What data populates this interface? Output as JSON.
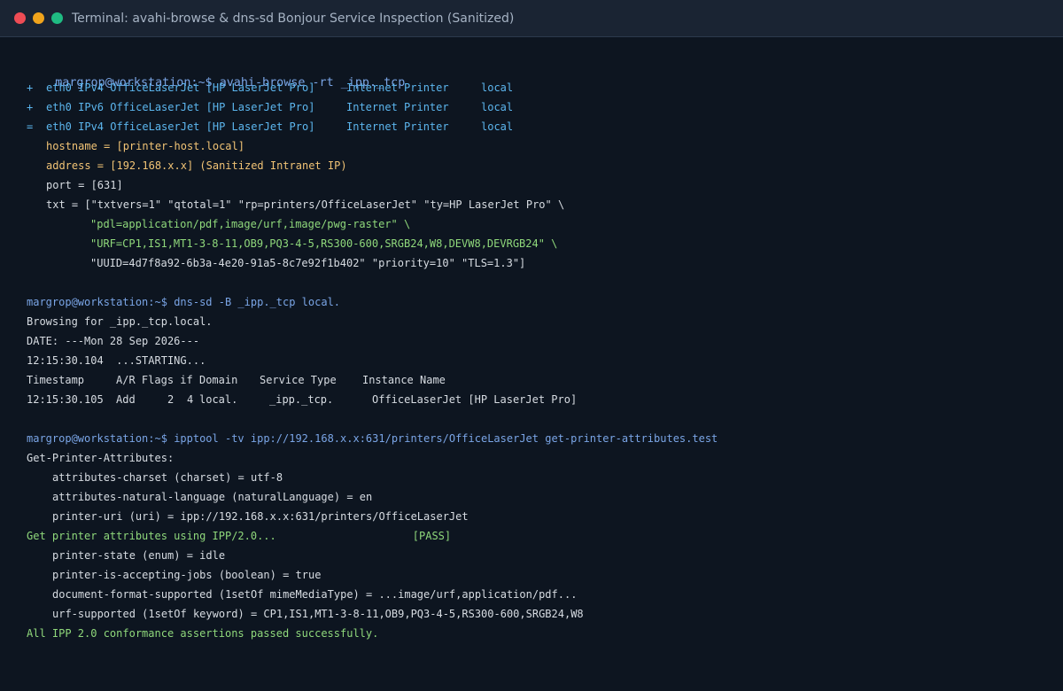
{
  "window": {
    "title": "Terminal: avahi-browse & dns-sd Bonjour Service Inspection (Sanitized)",
    "controls": {
      "close_color": "#ee4c55",
      "minimize_color": "#f0a41c",
      "maximize_color": "#1fbc83"
    }
  },
  "colors": {
    "background": "#0d1520",
    "prompt": "#7aa5e6",
    "command": "#7aa5e6",
    "default": "#d7dce2",
    "accent_blue": "#5cb6ee",
    "yellow": "#f1c375",
    "green": "#8fd87b"
  },
  "prompt": "margrop@workstation:~$",
  "block1": {
    "command": "avahi-browse -rt _ipp._tcp",
    "services": [
      {
        "marker": "+",
        "desc": "eth0 IPv4 OfficeLaserJet [HP LaserJet Pro]",
        "type": "Internet Printer",
        "domain": "local"
      },
      {
        "marker": "+",
        "desc": "eth0 IPv6 OfficeLaserJet [HP LaserJet Pro]",
        "type": "Internet Printer",
        "domain": "local"
      },
      {
        "marker": "=",
        "desc": "eth0 IPv4 OfficeLaserJet [HP LaserJet Pro]",
        "type": "Internet Printer",
        "domain": "local"
      }
    ],
    "hostname": "hostname = [printer-host.local]",
    "address": "address = [192.168.x.x] (Sanitized Intranet IP)",
    "port": "port = [631]",
    "txt_line1": "txt = [\"txtvers=1\" \"qtotal=1\" \"rp=printers/OfficeLaserJet\" \"ty=HP LaserJet Pro\" \\",
    "txt_line2": "\"pdl=application/pdf,image/urf,image/pwg-raster\" \\",
    "txt_line3": "\"URF=CP1,IS1,MT1-3-8-11,OB9,PQ3-4-5,RS300-600,SRGB24,W8,DEVW8,DEVRGB24\" \\",
    "txt_line4": "\"UUID=4d7f8a92-6b3a-4e20-91a5-8c7e92f1b402\" \"priority=10\" \"TLS=1.3\"]"
  },
  "block2": {
    "command": "dns-sd -B _ipp._tcp local.",
    "browsing": "Browsing for _ipp._tcp.local.",
    "date": "DATE: ---Mon 28 Sep 2026---",
    "starting": "12:15:30.104  ...STARTING...",
    "table_headers": {
      "timestamp": "Timestamp",
      "ar": "A/R",
      "flags": "Flags",
      "if": "if",
      "domain": "Domain",
      "service_type": "Service Type",
      "instance": "Instance Name"
    },
    "row": {
      "timestamp": "12:15:30.105",
      "ar": "Add",
      "flags": "2",
      "if": "4",
      "domain": "local.",
      "service_type": "_ipp._tcp.",
      "instance": "OfficeLaserJet [HP LaserJet Pro]"
    }
  },
  "block3": {
    "command": "ipptool -tv ipp://192.168.x.x:631/printers/OfficeLaserJet get-printer-attributes.test",
    "header": "Get-Printer-Attributes:",
    "request_attrs": [
      "attributes-charset (charset) = utf-8",
      "attributes-natural-language (naturalLanguage) = en",
      "printer-uri (uri) = ipp://192.168.x.x:631/printers/OfficeLaserJet"
    ],
    "test_name": "Get printer attributes using IPP/2.0...",
    "test_result": "[PASS]",
    "response_attrs": [
      "printer-state (enum) = idle",
      "printer-is-accepting-jobs (boolean) = true",
      "document-format-supported (1setOf mimeMediaType) = ...image/urf,application/pdf...",
      "urf-supported (1setOf keyword) = CP1,IS1,MT1-3-8-11,OB9,PQ3-4-5,RS300-600,SRGB24,W8"
    ],
    "summary": "All IPP 2.0 conformance assertions passed successfully."
  }
}
